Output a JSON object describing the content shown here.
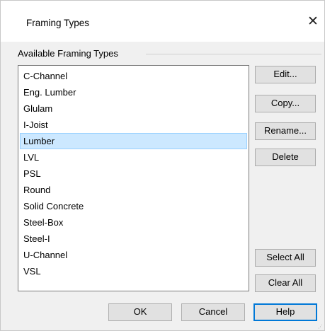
{
  "dialog": {
    "title": "Framing Types",
    "close_glyph": "✕",
    "group_label": "Available Framing Types"
  },
  "list": {
    "items": [
      {
        "label": "C-Channel",
        "selected": false
      },
      {
        "label": "Eng. Lumber",
        "selected": false
      },
      {
        "label": "Glulam",
        "selected": false
      },
      {
        "label": "I-Joist",
        "selected": false
      },
      {
        "label": "Lumber",
        "selected": true
      },
      {
        "label": "LVL",
        "selected": false
      },
      {
        "label": "PSL",
        "selected": false
      },
      {
        "label": "Round",
        "selected": false
      },
      {
        "label": "Solid Concrete",
        "selected": false
      },
      {
        "label": "Steel-Box",
        "selected": false
      },
      {
        "label": "Steel-I",
        "selected": false
      },
      {
        "label": "U-Channel",
        "selected": false
      },
      {
        "label": "VSL",
        "selected": false
      }
    ]
  },
  "side_buttons": {
    "edit": "Edit...",
    "copy": "Copy...",
    "rename": "Rename...",
    "delete": "Delete",
    "select_all": "Select All",
    "clear_all": "Clear All"
  },
  "footer": {
    "ok": "OK",
    "cancel": "Cancel",
    "help": "Help"
  },
  "colors": {
    "selection_bg": "#cce8ff",
    "selection_border": "#99d1ff",
    "default_button_border": "#0078d7"
  }
}
